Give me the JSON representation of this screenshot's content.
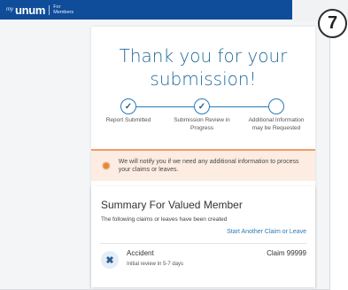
{
  "header": {
    "brand_my": "my",
    "brand_name": "unum",
    "brand_for": "For",
    "brand_members": "Members"
  },
  "badge": {
    "number": "7"
  },
  "confirmation": {
    "title_line1": "Thank you for your",
    "title_line2": "submission!"
  },
  "progress": {
    "steps": [
      {
        "label_line1": "Report Submitted",
        "label_line2": "",
        "state": "done"
      },
      {
        "label_line1": "Submission Review in",
        "label_line2": "Progress",
        "state": "done"
      },
      {
        "label_line1": "Additional Information",
        "label_line2": "may be Requested",
        "state": "pending"
      }
    ]
  },
  "notice": {
    "text": "We will notify you if we need any additional information to process your claims or leaves."
  },
  "summary": {
    "title": "Summary For Valued Member",
    "subtitle": "The following claims or leaves have been created",
    "link_label": "Start Another Claim or Leave",
    "claim": {
      "type": "Accident",
      "note": "Initial review in 5-7 days",
      "number": "Claim 99999"
    }
  },
  "colors": {
    "header_bg": "#0f4c9a",
    "accent": "#2b7ab6",
    "notice_bg": "#fdece1",
    "notice_border": "#f29b6b"
  }
}
